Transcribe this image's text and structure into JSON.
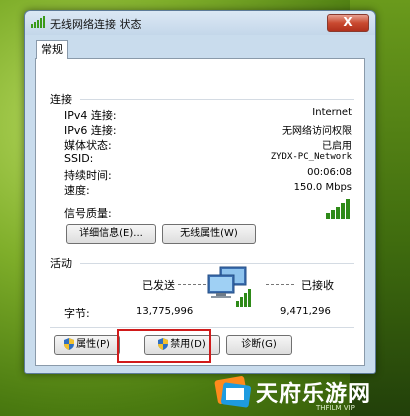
{
  "window": {
    "title": "无线网络连接 状态",
    "close_label": "X"
  },
  "tab": {
    "label": "常规"
  },
  "connection": {
    "group_label": "连接",
    "rows": [
      {
        "label": "IPv4 连接:",
        "value": "Internet"
      },
      {
        "label": "IPv6 连接:",
        "value": "无网络访问权限"
      },
      {
        "label": "媒体状态:",
        "value": "已启用"
      },
      {
        "label": "SSID:",
        "value": "ZYDX-PC_Network"
      },
      {
        "label": "持续时间:",
        "value": "00:06:08"
      },
      {
        "label": "速度:",
        "value": "150.0 Mbps"
      }
    ],
    "signal_label": "信号质量:",
    "signal_level": 1.0,
    "details_button": "详细信息(E)...",
    "wireless_props_button": "无线属性(W)"
  },
  "activity": {
    "group_label": "活动",
    "sent_label": "已发送",
    "received_label": "已接收",
    "bytes_label": "字节:",
    "sent_value": "13,775,996",
    "received_value": "9,471,296"
  },
  "buttons": {
    "properties": "属性(P)",
    "disable": "禁用(D)",
    "diagnose": "诊断(G)"
  },
  "watermark": {
    "brand": "天府乐游网",
    "sub": "THFILM VIP"
  },
  "colors": {
    "accent": "#d01a1a",
    "window_bg": "#c9dced"
  }
}
